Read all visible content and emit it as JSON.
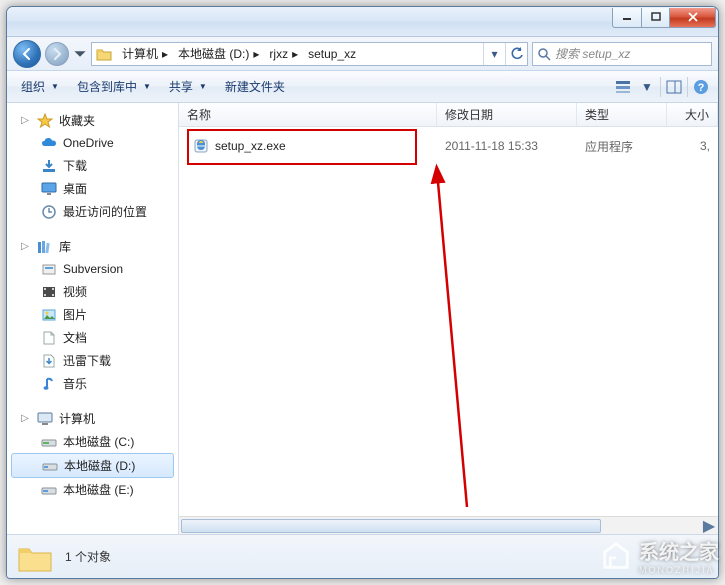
{
  "breadcrumbs": [
    "计算机",
    "本地磁盘 (D:)",
    "rjxz",
    "setup_xz"
  ],
  "search_placeholder": "搜索 setup_xz",
  "toolbar": {
    "organize": "组织",
    "include": "包含到库中",
    "share": "共享",
    "new_folder": "新建文件夹"
  },
  "columns": {
    "name": "名称",
    "date": "修改日期",
    "type": "类型",
    "size": "大小"
  },
  "sidebar": {
    "favorites": {
      "label": "收藏夹",
      "items": [
        "OneDrive",
        "下载",
        "桌面",
        "最近访问的位置"
      ]
    },
    "libraries": {
      "label": "库",
      "items": [
        "Subversion",
        "视频",
        "图片",
        "文档",
        "迅雷下载",
        "音乐"
      ]
    },
    "computer": {
      "label": "计算机",
      "items": [
        "本地磁盘 (C:)",
        "本地磁盘 (D:)",
        "本地磁盘 (E:)"
      ],
      "selected_index": 1
    }
  },
  "files": [
    {
      "name": "setup_xz.exe",
      "date": "2011-11-18 15:33",
      "type": "应用程序",
      "size": "3,"
    }
  ],
  "status": {
    "count_label": "1 个对象"
  },
  "watermark": {
    "brand": "系统之家",
    "sub": "MONOZHIJIA"
  }
}
